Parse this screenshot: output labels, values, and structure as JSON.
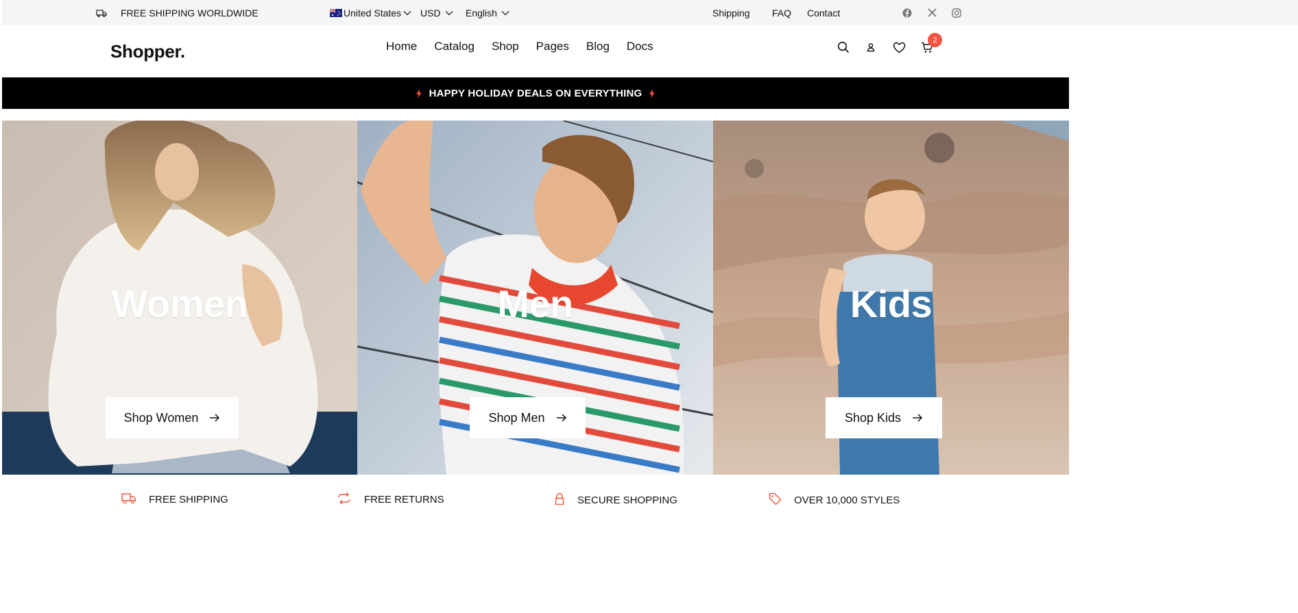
{
  "topbar": {
    "shipping_notice": "FREE SHIPPING WORLDWIDE",
    "country": "United States",
    "currency": "USD",
    "language": "English",
    "links": [
      "Shipping",
      "FAQ",
      "Contact"
    ],
    "social_icons": [
      "facebook-icon",
      "x-icon",
      "instagram-icon"
    ]
  },
  "navbar": {
    "logo": "Shopper.",
    "links": [
      "Home",
      "Catalog",
      "Shop",
      "Pages",
      "Blog",
      "Docs"
    ],
    "icons": [
      "search-icon",
      "user-icon",
      "heart-icon",
      "cart-icon"
    ],
    "cart_count": "2"
  },
  "promo": {
    "text": "HAPPY HOLIDAY DEALS ON EVERYTHING",
    "accent_color": "#f0533f"
  },
  "categories": [
    {
      "title": "Women",
      "cta": "Shop Women"
    },
    {
      "title": "Men",
      "cta": "Shop Men"
    },
    {
      "title": "Kids",
      "cta": "Shop Kids"
    }
  ],
  "features": [
    {
      "icon": "truck-icon",
      "label": "FREE SHIPPING"
    },
    {
      "icon": "refresh-icon",
      "label": "FREE RETURNS"
    },
    {
      "icon": "lock-icon",
      "label": "SECURE SHOPPING"
    },
    {
      "icon": "tag-icon",
      "label": "OVER 10,000 STYLES"
    }
  ],
  "colors": {
    "accent": "#f0533f",
    "topbar_bg": "#f5f5f5",
    "promo_bg": "#000000"
  }
}
